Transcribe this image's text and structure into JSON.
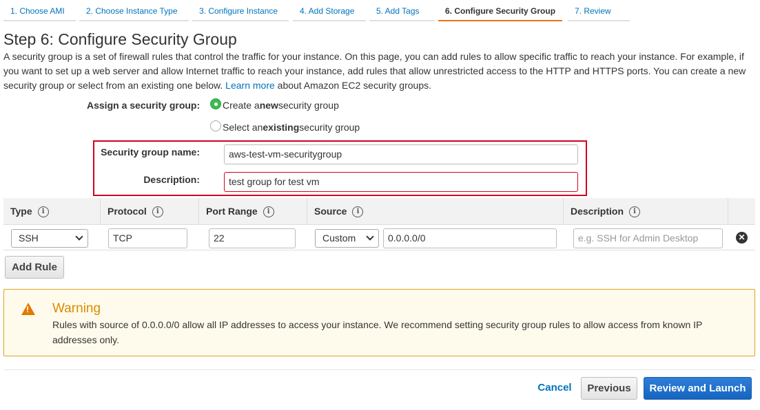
{
  "wizard": {
    "tabs": [
      {
        "label": "1. Choose AMI"
      },
      {
        "label": "2. Choose Instance Type"
      },
      {
        "label": "3. Configure Instance"
      },
      {
        "label": "4. Add Storage"
      },
      {
        "label": "5. Add Tags"
      },
      {
        "label": "6. Configure Security Group",
        "active": true
      },
      {
        "label": "7. Review"
      }
    ]
  },
  "page": {
    "title": "Step 6: Configure Security Group",
    "intro_text": "A security group is a set of firewall rules that control the traffic for your instance. On this page, you can add rules to allow specific traffic to reach your instance. For example, if you want to set up a web server and allow Internet traffic to reach your instance, add rules that allow unrestricted access to the HTTP and HTTPS ports. You can create a new security group or select from an existing one below.",
    "learn_more": "Learn more",
    "intro_suffix": "about Amazon EC2 security groups."
  },
  "assign": {
    "label": "Assign a security group:",
    "option_create_prefix": "Create a ",
    "option_create_bold": "new",
    "option_create_suffix": " security group",
    "option_existing_prefix": "Select an ",
    "option_existing_bold": "existing",
    "option_existing_suffix": " security group",
    "selected": "create"
  },
  "security_group": {
    "name_label": "Security group name:",
    "name_value": "aws-test-vm-securitygroup",
    "description_label": "Description:",
    "description_value": "test group for test vm"
  },
  "rules_table": {
    "headers": [
      "Type",
      "Protocol",
      "Port Range",
      "Source",
      "Description"
    ],
    "info_glyph": "i",
    "rows": [
      {
        "type": "SSH",
        "protocol": "TCP",
        "port_range": "22",
        "source_mode": "Custom",
        "source_cidr": "0.0.0.0/0",
        "description_placeholder": "e.g. SSH for Admin Desktop"
      }
    ],
    "add_rule": "Add Rule"
  },
  "warning": {
    "title": "Warning",
    "body": "Rules with source of 0.0.0.0/0 allow all IP addresses to access your instance. We recommend setting security group rules to allow access from known IP addresses only."
  },
  "footer": {
    "cancel": "Cancel",
    "previous": "Previous",
    "review_launch": "Review and Launch"
  },
  "colors": {
    "accent_orange": "#ec7211",
    "link_blue": "#0073bb",
    "highlight_red": "#d0021b",
    "radio_green": "#3cba54",
    "primary_button": "#1565c0"
  }
}
